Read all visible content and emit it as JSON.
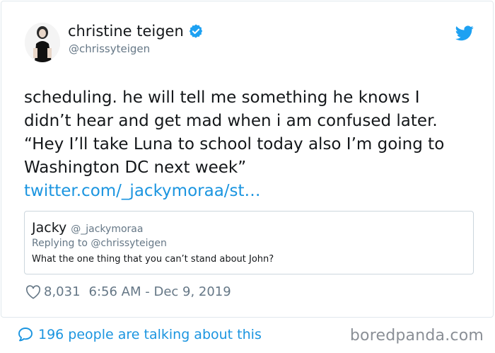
{
  "user": {
    "name": "christine teigen",
    "handle": "@chrissyteigen"
  },
  "tweet": {
    "lines": [
      "scheduling. he will tell me something he knows I",
      "didn’t hear and get mad when i am confused later.",
      "“Hey I’ll take Luna to school today also I’m going to",
      "Washington DC next week”"
    ],
    "link": "twitter.com/_jackymoraa/st…"
  },
  "quote": {
    "name": "Jacky",
    "handle": "@_jackymoraa",
    "replying_to": "Replying to @chrissyteigen",
    "text": "What the one thing that you can’t stand about John?"
  },
  "meta": {
    "likes": "8,031",
    "timestamp": "6:56 AM - Dec 9, 2019"
  },
  "footer": {
    "talking": "196 people are talking about this"
  },
  "watermark": "boredpanda.com",
  "icons": {
    "verified": "verified-badge-icon",
    "bird": "twitter-bird-icon",
    "heart": "heart-icon",
    "bubble": "speech-bubble-icon"
  },
  "colors": {
    "link": "#1b95e0",
    "secondary": "#657786",
    "border": "#e1e8ed"
  }
}
